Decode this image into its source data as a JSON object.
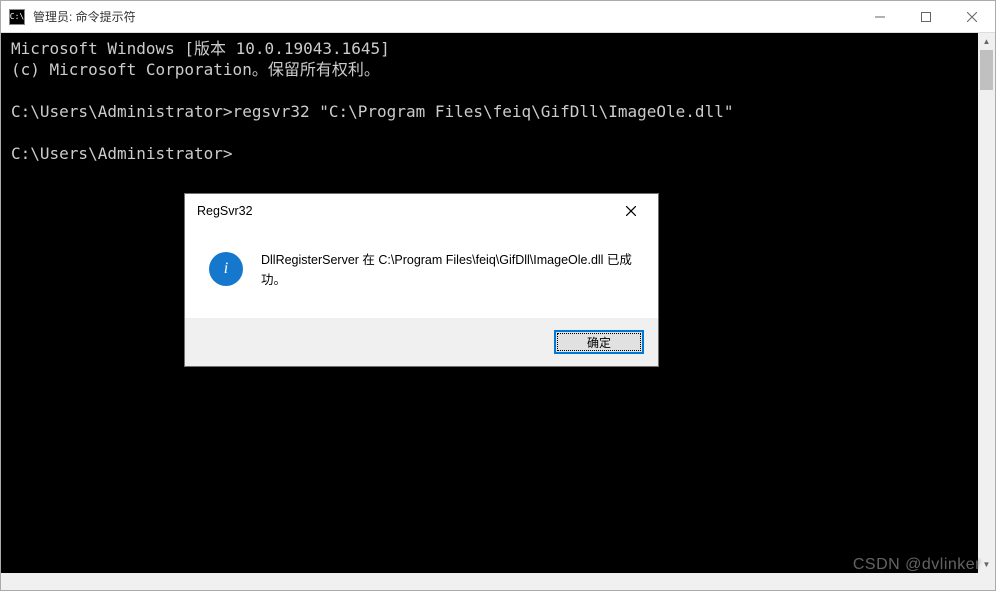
{
  "window": {
    "title": "管理员: 命令提示符",
    "icon_label": "C:\\"
  },
  "console": {
    "line1": "Microsoft Windows [版本 10.0.19043.1645]",
    "line2": "(c) Microsoft Corporation。保留所有权利。",
    "line3": "",
    "prompt1": "C:\\Users\\Administrator>regsvr32 \"C:\\Program Files\\feiq\\GifDll\\ImageOle.dll\"",
    "line5": "",
    "prompt2": "C:\\Users\\Administrator>"
  },
  "dialog": {
    "title": "RegSvr32",
    "icon_glyph": "i",
    "message": "DllRegisterServer 在 C:\\Program Files\\feiq\\GifDll\\ImageOle.dll 已成功。",
    "ok_label": "确定"
  },
  "watermark": "CSDN @dvlinker"
}
